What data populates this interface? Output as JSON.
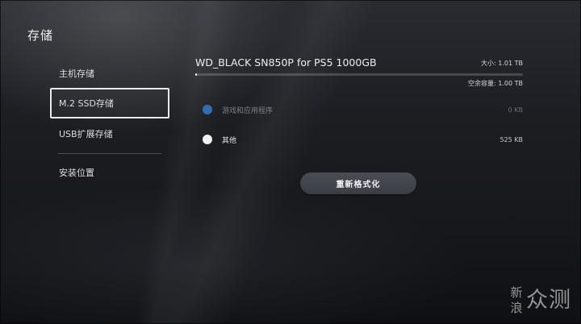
{
  "page": {
    "title": "存储"
  },
  "sidebar": {
    "items": [
      {
        "label": "主机存储",
        "selected": false
      },
      {
        "label": "M.2 SSD存储",
        "selected": true
      },
      {
        "label": "USB扩展存储",
        "selected": false
      },
      {
        "label": "安装位置",
        "selected": false
      }
    ]
  },
  "device": {
    "name": "WD_BLACK SN850P for PS5 1000GB",
    "size_label": "大小: 1.01 TB",
    "free_label": "空余容量: 1.00 TB",
    "used_fraction": 0.005
  },
  "usage": [
    {
      "label": "游戏和应用程序",
      "value": "0 KB",
      "color": "#2f6fb0"
    },
    {
      "label": "其他",
      "value": "525 KB",
      "color": "#f0f0f0"
    }
  ],
  "actions": {
    "format_label": "重新格式化"
  },
  "watermark": {
    "small_top": "新",
    "small_bottom": "浪",
    "big": "众测"
  },
  "colors": {
    "accent": "#2f6fb0",
    "background": "#1d1e23"
  }
}
